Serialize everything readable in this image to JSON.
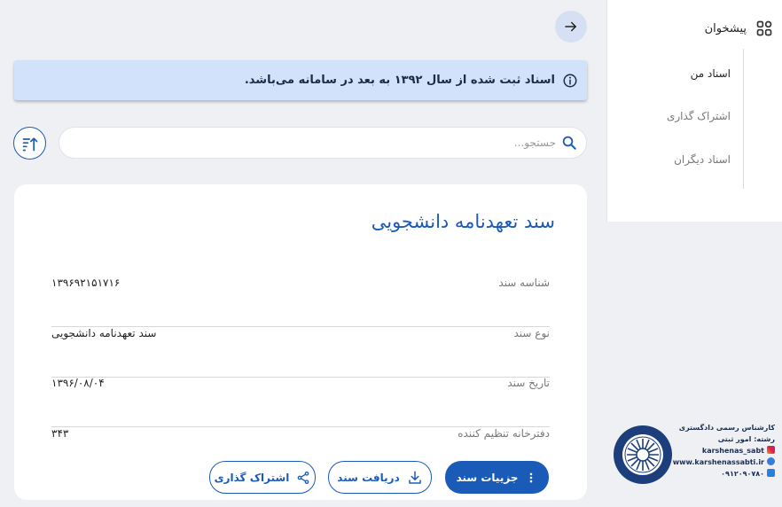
{
  "alert": {
    "text": "اسناد ثبت شده از سال ۱۳۹۲ به بعد در سامانه می‌باشد."
  },
  "search": {
    "placeholder": "جستجو..."
  },
  "document": {
    "title": "سند تعهدنامه دانشجویی",
    "fields": [
      {
        "label": "شناسه سند",
        "value": "۱۳۹۶۹۲۱۵۱۷۱۶"
      },
      {
        "label": "نوع سند",
        "value": "سند تعهدنامه دانشجویی"
      },
      {
        "label": "تاریخ سند",
        "value": "۱۳۹۶/۰۸/۰۴"
      },
      {
        "label": "دفترخانه تنظیم کننده",
        "value": "۳۴۳"
      }
    ],
    "actions": {
      "details": "جزییات سند",
      "download": "دریافت سند",
      "share": "اشتراک گذاری"
    }
  },
  "sidebar": {
    "title": "پیشخوان",
    "items": [
      {
        "label": "اسناد من",
        "active": true
      },
      {
        "label": "اشتراک گذاری",
        "active": false
      },
      {
        "label": "اسناد دیگران",
        "active": false
      }
    ]
  },
  "watermark": {
    "line1": "کارشناس رسمی دادگستری",
    "line2": "رشته: امور ثبتی",
    "instagram": "karshenas_sabt",
    "website": "www.karshenassabti.ir",
    "phone": "۰۹۱۲۰۹۰۷۸۰"
  },
  "colors": {
    "primary": "#1b5bb8",
    "alert_bg": "#d3e2fb",
    "page_bg": "#eef0f3"
  }
}
